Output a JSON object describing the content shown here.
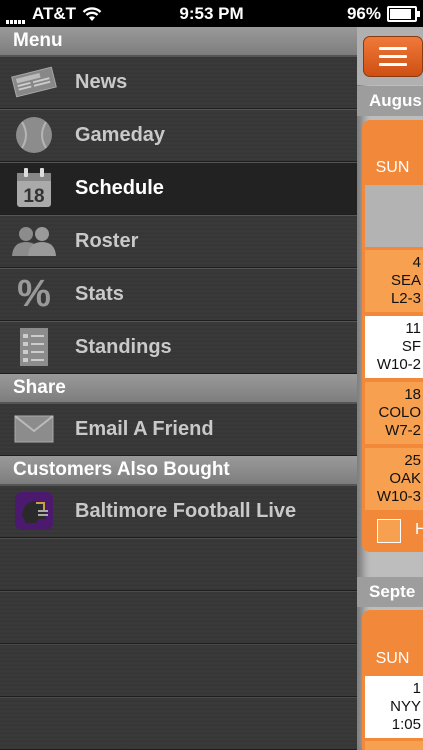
{
  "status_bar": {
    "carrier": "AT&T",
    "time": "9:53 PM",
    "battery": "96%"
  },
  "menu": {
    "sections": [
      {
        "title": "Menu"
      },
      {
        "title": "Share"
      },
      {
        "title": "Customers Also Bought"
      }
    ],
    "items": [
      {
        "label": "News",
        "icon": "newspaper-icon"
      },
      {
        "label": "Gameday",
        "icon": "baseball-icon"
      },
      {
        "label": "Schedule",
        "icon": "calendar-icon",
        "active": true
      },
      {
        "label": "Roster",
        "icon": "people-icon"
      },
      {
        "label": "Stats",
        "icon": "percent-icon"
      },
      {
        "label": "Standings",
        "icon": "list-icon"
      }
    ],
    "share_items": [
      {
        "label": "Email A Friend",
        "icon": "envelope-icon"
      }
    ],
    "bought_items": [
      {
        "label": "Baltimore Football Live",
        "icon": "app-thumbnail-icon"
      }
    ]
  },
  "calendar": {
    "months": [
      "Augus",
      "Septe"
    ],
    "day_header": "SUN",
    "august_cells": [
      {
        "lines": [
          "",
          "",
          ""
        ],
        "style": "grey"
      },
      {
        "lines": [
          "4",
          "SEA",
          "L2-3"
        ],
        "style": "orange"
      },
      {
        "lines": [
          "11",
          "SF",
          "W10-2"
        ],
        "style": "white"
      },
      {
        "lines": [
          "18",
          "COLO",
          "W7-2"
        ],
        "style": "orange"
      },
      {
        "lines": [
          "25",
          "OAK",
          "W10-3"
        ],
        "style": "orange"
      }
    ],
    "legend_label": "H",
    "september_cells": [
      {
        "lines": [
          "1",
          "NYY",
          "1:05"
        ],
        "style": "white"
      }
    ],
    "calendar_day_number": "18"
  }
}
